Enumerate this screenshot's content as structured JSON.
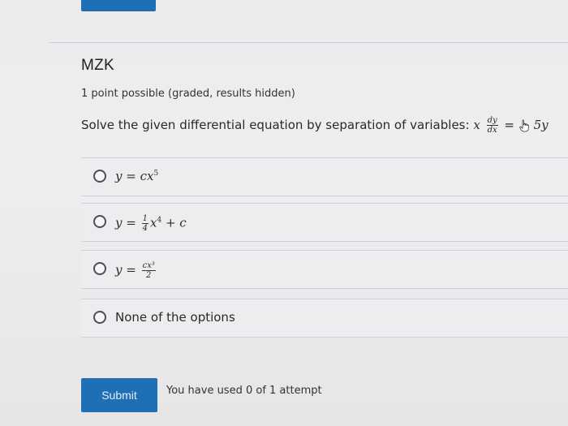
{
  "problem": {
    "title": "MZK",
    "meta": "1 point possible (graded, results hidden)",
    "question_text": "Solve the given differential equation by separation of variables:",
    "equation": {
      "lhs": "x",
      "frac_num": "dy",
      "frac_den": "dx",
      "rhs": "5y"
    }
  },
  "options": [
    {
      "pre": "y = cx",
      "sup": "5"
    },
    {
      "pre": "y =",
      "frac_num": "1",
      "frac_den": "4",
      "mid": "x",
      "sup": "4",
      "post": " + c"
    },
    {
      "pre": "y =",
      "frac_num": "cx³",
      "frac_den": "2"
    },
    {
      "text": "None of the options"
    }
  ],
  "footer": {
    "submit_label": "Submit",
    "attempts_text": "You have used 0 of 1 attempt"
  },
  "colors": {
    "accent": "#1f6fb5"
  },
  "icons": [
    "radio-button-icon",
    "hand-pointer-cursor-icon"
  ]
}
